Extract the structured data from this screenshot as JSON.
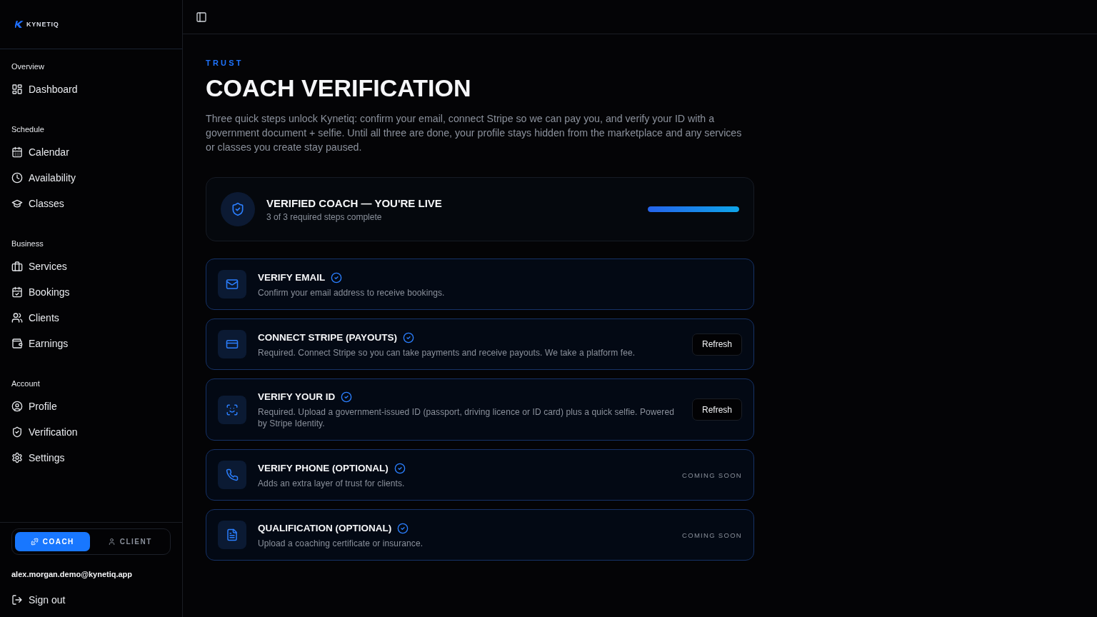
{
  "brand": {
    "name": "KYNETIQ"
  },
  "sidebar": {
    "sections": [
      {
        "heading": "Overview",
        "items": [
          {
            "label": "Dashboard"
          }
        ]
      },
      {
        "heading": "Schedule",
        "items": [
          {
            "label": "Calendar"
          },
          {
            "label": "Availability"
          },
          {
            "label": "Classes"
          }
        ]
      },
      {
        "heading": "Business",
        "items": [
          {
            "label": "Services"
          },
          {
            "label": "Bookings"
          },
          {
            "label": "Clients"
          },
          {
            "label": "Earnings"
          }
        ]
      },
      {
        "heading": "Account",
        "items": [
          {
            "label": "Profile"
          },
          {
            "label": "Verification"
          },
          {
            "label": "Settings"
          }
        ]
      }
    ],
    "mode_toggle": [
      {
        "label": "COACH",
        "selected": true
      },
      {
        "label": "CLIENT",
        "selected": false
      }
    ],
    "account_email": "alex.morgan.demo@kynetiq.app",
    "sign_out": "Sign out"
  },
  "page": {
    "eyebrow": "TRUST",
    "title": "COACH VERIFICATION",
    "description": "Three quick steps unlock Kynetiq: confirm your email, connect Stripe so we can pay you, and verify your ID with a government document + selfie. Until all three are done, your profile stays hidden from the marketplace and any services or classes you create stay paused."
  },
  "status": {
    "title": "VERIFIED COACH — YOU'RE LIVE",
    "subtitle": "3 of 3 required steps complete",
    "level": 1
  },
  "steps": [
    {
      "title": "VERIFY EMAIL",
      "complete": true,
      "description": "Confirm your email address to receive bookings."
    },
    {
      "title": "CONNECT STRIPE (PAYOUTS)",
      "complete": true,
      "description": "Required. Connect Stripe so you can take payments and receive payouts. We take a platform fee.",
      "action": {
        "kind": "button",
        "label": "Refresh"
      }
    },
    {
      "title": "VERIFY YOUR ID",
      "complete": true,
      "description": "Required. Upload a government-issued ID (passport, driving licence or ID card) plus a quick selfie. Powered by Stripe Identity.",
      "action": {
        "kind": "button",
        "label": "Refresh"
      }
    },
    {
      "title": "VERIFY PHONE (OPTIONAL)",
      "complete": true,
      "description": "Adds an extra layer of trust for clients.",
      "action": {
        "kind": "note",
        "label": "COMING SOON"
      }
    },
    {
      "title": "QUALIFICATION (OPTIONAL)",
      "complete": true,
      "description": "Upload a coaching certificate or insurance.",
      "action": {
        "kind": "note",
        "label": "COMING SOON"
      }
    }
  ]
}
